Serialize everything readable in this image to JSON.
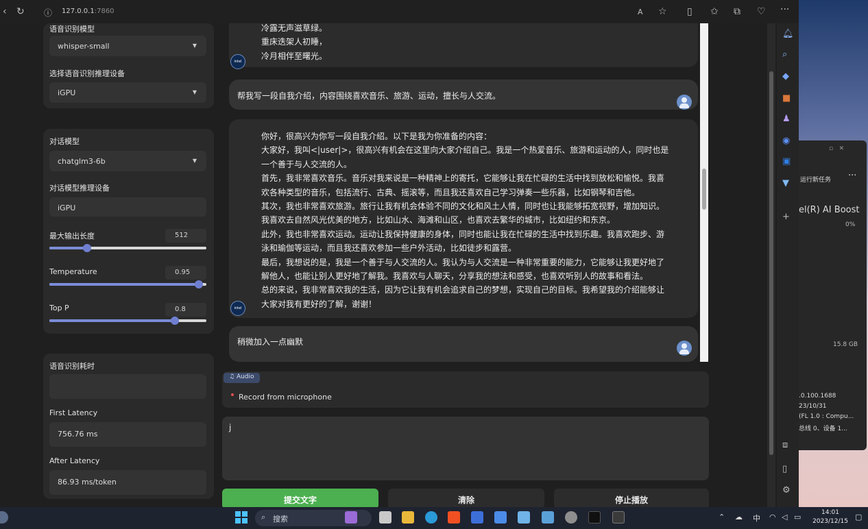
{
  "browser": {
    "url_host": "127.0.0.1",
    "url_port": ":7860"
  },
  "sidebar": {
    "asr_model_label": "语音识别模型",
    "asr_model_value": "whisper-small",
    "asr_device_label": "选择语音识别推理设备",
    "asr_device_value": "iGPU",
    "chat_model_label": "对话模型",
    "chat_model_value": "chatglm3-6b",
    "chat_device_label": "对话模型推理设备",
    "chat_device_value": "iGPU",
    "max_len_label": "最大输出长度",
    "max_len_value": "512",
    "max_len_fraction": 0.24,
    "temperature_label": "Temperature",
    "temperature_value": "0.95",
    "temperature_fraction": 0.95,
    "top_p_label": "Top P",
    "top_p_value": "0.8",
    "top_p_fraction": 0.8,
    "asr_time_label": "语音识别耗时",
    "asr_time_value": "",
    "first_latency_label": "First Latency",
    "first_latency_value": "756.76 ms",
    "after_latency_label": "After Latency",
    "after_latency_value": "86.93 ms/token"
  },
  "chat": {
    "poem_tail": "冷露无声滋草绿。\n重床迭架人初睡，\n冷月相伴至曙光。",
    "user_msg_1": "帮我写一段自我介绍，内容围绕喜欢音乐、旅游、运动，擅长与人交流。",
    "bot_reply": "你好，很高兴为你写一段自我介绍。以下是我为你准备的内容：\n大家好，我叫<|user|>，很高兴有机会在这里向大家介绍自己。我是一个热爱音乐、旅游和运动的人，同时也是\n一个善于与人交流的人。\n首先，我非常喜欢音乐。音乐对我来说是一种精神上的寄托，它能够让我在忙碌的生活中找到放松和愉悦。我喜\n欢各种类型的音乐，包括流行、古典、摇滚等，而且我还喜欢自己学习弹奏一些乐器，比如钢琴和吉他。\n其次，我也非常喜欢旅游。旅行让我有机会体验不同的文化和风土人情，同时也让我能够拓宽视野，增加知识。\n我喜欢去自然风光优美的地方，比如山水、海滩和山区，也喜欢去繁华的城市，比如纽约和东京。\n此外，我也非常喜欢运动。运动让我保持健康的身体，同时也能让我在忙碌的生活中找到乐趣。我喜欢跑步、游\n泳和瑜伽等运动，而且我还喜欢参加一些户外活动，比如徒步和露营。\n最后，我想说的是，我是一个善于与人交流的人。我认为与人交流是一种非常重要的能力，它能够让我更好地了\n解他人，也能让别人更好地了解我。我喜欢与人聊天，分享我的想法和感受，也喜欢听别人的故事和看法。\n总的来说，我非常喜欢我的生活，因为它让我有机会追求自己的梦想，实现自己的目标。我希望我的介绍能够让\n大家对我有更好的了解，谢谢！",
    "user_msg_2": "稍微加入一点幽默",
    "bot_avatar_text": "intel"
  },
  "audio": {
    "badge": "Audio",
    "record_label": "Record from microphone"
  },
  "input": {
    "value": "j"
  },
  "buttons": {
    "submit": "提交文字",
    "clear": "清除",
    "stop": "停止播放"
  },
  "bg_window": {
    "menu_label": "运行新任务",
    "more": "···",
    "title": "el(R) AI Boost",
    "percent": "0%",
    "size": "15.8 GB",
    "line1": ".0.100.1688",
    "line2": "23/10/31",
    "line3": "(FL 1.0 : Compu...",
    "line4": "总线 0、设备 1..."
  },
  "taskbar": {
    "search_placeholder": "搜索",
    "ime": "中",
    "time": "14:01",
    "date": "2023/12/15"
  },
  "colors": {
    "accent": "#6f7fd0",
    "submit_green": "#4caf50",
    "panel": "#2a2a2a"
  }
}
